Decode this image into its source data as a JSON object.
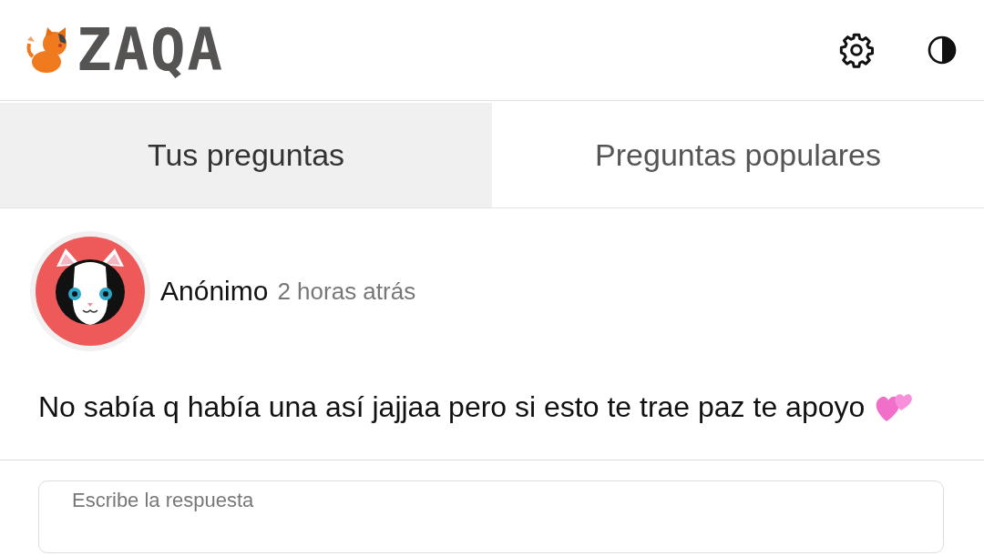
{
  "header": {
    "logo_text": "ZAQA"
  },
  "tabs": [
    {
      "label": "Tus preguntas",
      "selected": true
    },
    {
      "label": "Preguntas populares",
      "selected": false
    }
  ],
  "question": {
    "author": "Anónimo",
    "time": "2 horas atrás",
    "text": "No sabía q había una así jajjaa pero si esto te trae paz te apoyo"
  },
  "answer": {
    "placeholder": "Escribe la respuesta"
  }
}
